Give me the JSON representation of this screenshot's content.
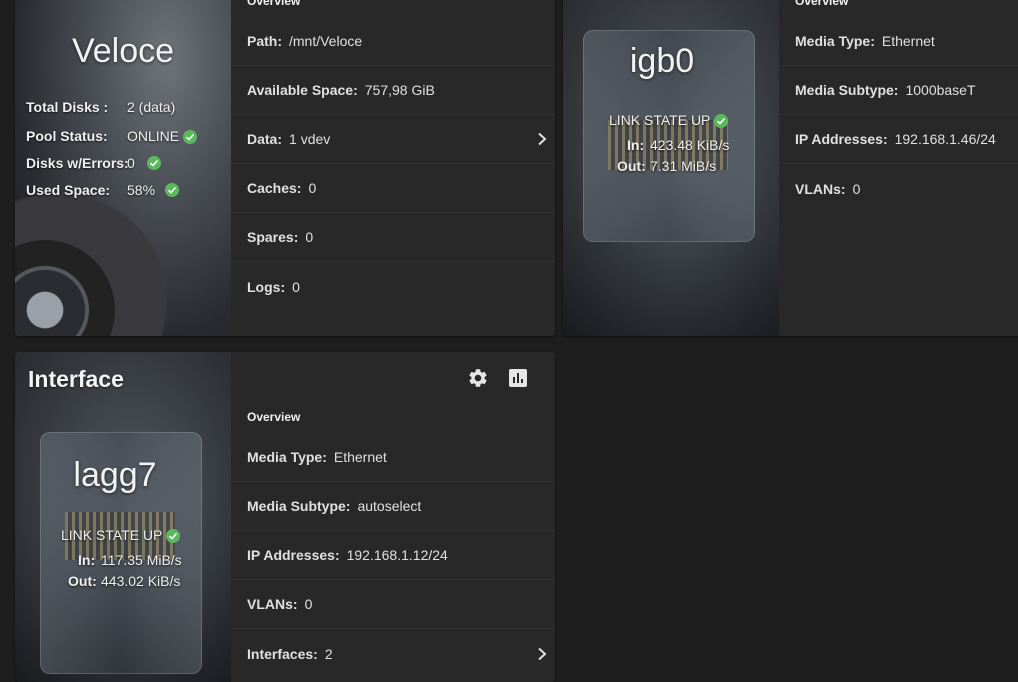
{
  "pool": {
    "name": "Veloce",
    "overview_label": "Overview",
    "total_disks_label": "Total Disks :",
    "total_disks_value": "2 (data)",
    "pool_status_label": "Pool Status:",
    "pool_status_value": "ONLINE",
    "disks_errors_label": "Disks w/Errors:",
    "disks_errors_value": "0",
    "used_space_label": "Used Space:",
    "used_space_value": "58%",
    "rows": [
      {
        "label": "Path:",
        "value": "/mnt/Veloce"
      },
      {
        "label": "Available Space:",
        "value": "757,98 GiB"
      },
      {
        "label": "Data:",
        "value": "1 vdev"
      },
      {
        "label": "Caches:",
        "value": "0"
      },
      {
        "label": "Spares:",
        "value": "0"
      },
      {
        "label": "Logs:",
        "value": "0"
      }
    ]
  },
  "igb0": {
    "name": "igb0",
    "overview_label": "Overview",
    "link_state": "LINK STATE UP",
    "in_label": "In:",
    "in_value": "423.48 KiB/s",
    "out_label": "Out:",
    "out_value": "7.31 MiB/s",
    "rows": [
      {
        "label": "Media Type:",
        "value": "Ethernet"
      },
      {
        "label": "Media Subtype:",
        "value": "1000baseT"
      },
      {
        "label": "IP Addresses:",
        "value": "192.168.1.46/24"
      },
      {
        "label": "VLANs:",
        "value": "0"
      }
    ]
  },
  "lagg7": {
    "card_title": "Interface",
    "name": "lagg7",
    "overview_label": "Overview",
    "link_state": "LINK STATE UP",
    "in_label": "In:",
    "in_value": "117.35 MiB/s",
    "out_label": "Out:",
    "out_value": "443.02 KiB/s",
    "rows": [
      {
        "label": "Media Type:",
        "value": "Ethernet"
      },
      {
        "label": "Media Subtype:",
        "value": "autoselect"
      },
      {
        "label": "IP Addresses:",
        "value": "192.168.1.12/24"
      },
      {
        "label": "VLANs:",
        "value": "0"
      },
      {
        "label": "Interfaces:",
        "value": "2"
      }
    ]
  },
  "colors": {
    "ok": "#5cb85c",
    "card": "#282828",
    "bg": "#1e1e1e"
  },
  "icons": {
    "settings": "gear-icon",
    "stats": "bar-chart-icon",
    "status": "check-circle-icon",
    "expand": "chevron-right-icon"
  }
}
